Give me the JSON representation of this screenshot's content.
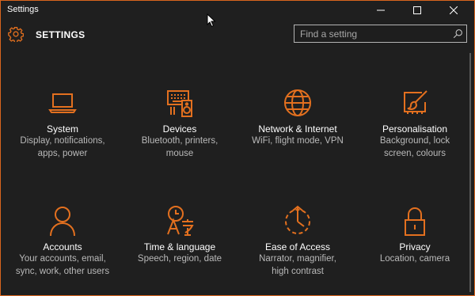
{
  "window": {
    "title": "Settings",
    "minimize_label": "—",
    "maximize_label": "☐",
    "close_label": "✕",
    "accent_color": "#e3701f"
  },
  "header": {
    "heading": "SETTINGS",
    "icon": "gear-icon"
  },
  "search": {
    "placeholder": "Find a setting",
    "value": "",
    "icon": "search-icon"
  },
  "tiles": [
    {
      "name": "System",
      "desc_line1": "Display, notifications,",
      "desc_line2": "apps, power",
      "icon": "laptop-icon"
    },
    {
      "name": "Devices",
      "desc_line1": "Bluetooth, printers,",
      "desc_line2": "mouse",
      "icon": "devices-icon"
    },
    {
      "name": "Network & Internet",
      "desc_line1": "WiFi, flight mode, VPN",
      "desc_line2": "",
      "icon": "globe-icon"
    },
    {
      "name": "Personalisation",
      "desc_line1": "Background, lock",
      "desc_line2": "screen, colours",
      "icon": "paintbrush-icon"
    },
    {
      "name": "Accounts",
      "desc_line1": "Your accounts, email,",
      "desc_line2": "sync, work, other users",
      "icon": "person-icon"
    },
    {
      "name": "Time & language",
      "desc_line1": "Speech, region, date",
      "desc_line2": "",
      "icon": "time-language-icon"
    },
    {
      "name": "Ease of Access",
      "desc_line1": "Narrator, magnifier,",
      "desc_line2": "high contrast",
      "icon": "ease-of-access-icon"
    },
    {
      "name": "Privacy",
      "desc_line1": "Location, camera",
      "desc_line2": "",
      "icon": "lock-icon"
    }
  ]
}
